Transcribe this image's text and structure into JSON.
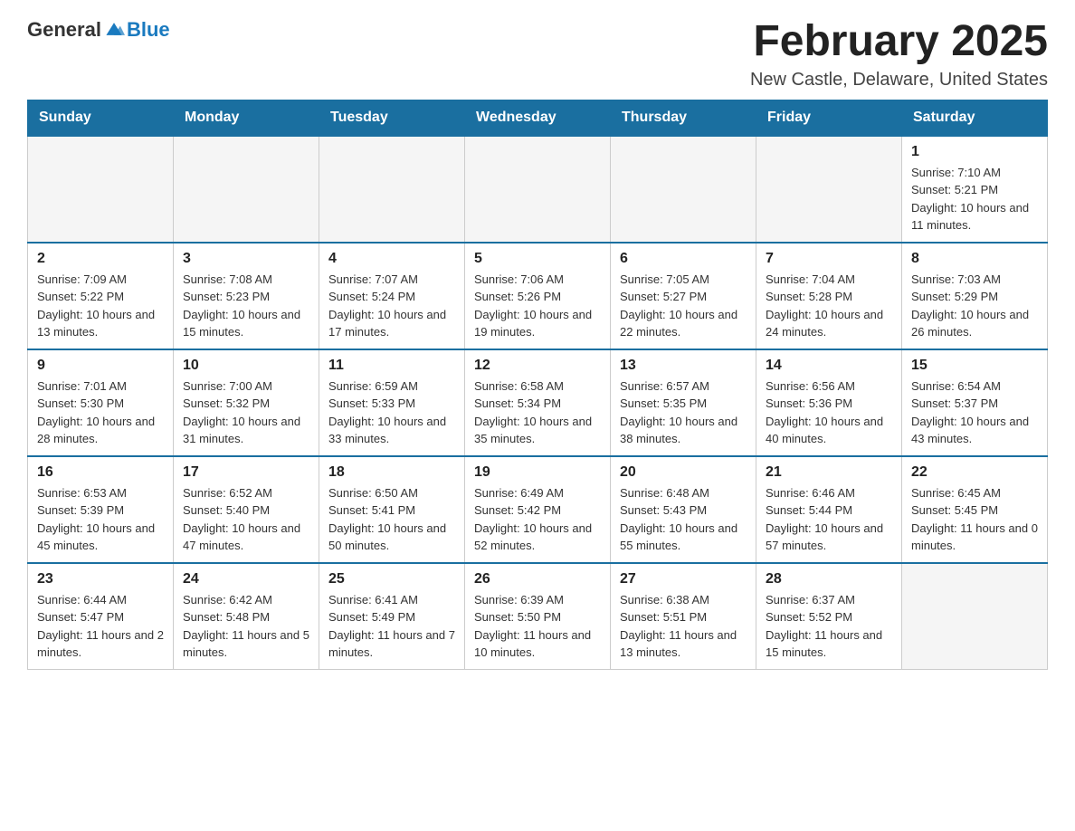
{
  "logo": {
    "general": "General",
    "blue": "Blue"
  },
  "title": "February 2025",
  "subtitle": "New Castle, Delaware, United States",
  "weekdays": [
    "Sunday",
    "Monday",
    "Tuesday",
    "Wednesday",
    "Thursday",
    "Friday",
    "Saturday"
  ],
  "weeks": [
    [
      {
        "day": "",
        "info": ""
      },
      {
        "day": "",
        "info": ""
      },
      {
        "day": "",
        "info": ""
      },
      {
        "day": "",
        "info": ""
      },
      {
        "day": "",
        "info": ""
      },
      {
        "day": "",
        "info": ""
      },
      {
        "day": "1",
        "info": "Sunrise: 7:10 AM\nSunset: 5:21 PM\nDaylight: 10 hours and 11 minutes."
      }
    ],
    [
      {
        "day": "2",
        "info": "Sunrise: 7:09 AM\nSunset: 5:22 PM\nDaylight: 10 hours and 13 minutes."
      },
      {
        "day": "3",
        "info": "Sunrise: 7:08 AM\nSunset: 5:23 PM\nDaylight: 10 hours and 15 minutes."
      },
      {
        "day": "4",
        "info": "Sunrise: 7:07 AM\nSunset: 5:24 PM\nDaylight: 10 hours and 17 minutes."
      },
      {
        "day": "5",
        "info": "Sunrise: 7:06 AM\nSunset: 5:26 PM\nDaylight: 10 hours and 19 minutes."
      },
      {
        "day": "6",
        "info": "Sunrise: 7:05 AM\nSunset: 5:27 PM\nDaylight: 10 hours and 22 minutes."
      },
      {
        "day": "7",
        "info": "Sunrise: 7:04 AM\nSunset: 5:28 PM\nDaylight: 10 hours and 24 minutes."
      },
      {
        "day": "8",
        "info": "Sunrise: 7:03 AM\nSunset: 5:29 PM\nDaylight: 10 hours and 26 minutes."
      }
    ],
    [
      {
        "day": "9",
        "info": "Sunrise: 7:01 AM\nSunset: 5:30 PM\nDaylight: 10 hours and 28 minutes."
      },
      {
        "day": "10",
        "info": "Sunrise: 7:00 AM\nSunset: 5:32 PM\nDaylight: 10 hours and 31 minutes."
      },
      {
        "day": "11",
        "info": "Sunrise: 6:59 AM\nSunset: 5:33 PM\nDaylight: 10 hours and 33 minutes."
      },
      {
        "day": "12",
        "info": "Sunrise: 6:58 AM\nSunset: 5:34 PM\nDaylight: 10 hours and 35 minutes."
      },
      {
        "day": "13",
        "info": "Sunrise: 6:57 AM\nSunset: 5:35 PM\nDaylight: 10 hours and 38 minutes."
      },
      {
        "day": "14",
        "info": "Sunrise: 6:56 AM\nSunset: 5:36 PM\nDaylight: 10 hours and 40 minutes."
      },
      {
        "day": "15",
        "info": "Sunrise: 6:54 AM\nSunset: 5:37 PM\nDaylight: 10 hours and 43 minutes."
      }
    ],
    [
      {
        "day": "16",
        "info": "Sunrise: 6:53 AM\nSunset: 5:39 PM\nDaylight: 10 hours and 45 minutes."
      },
      {
        "day": "17",
        "info": "Sunrise: 6:52 AM\nSunset: 5:40 PM\nDaylight: 10 hours and 47 minutes."
      },
      {
        "day": "18",
        "info": "Sunrise: 6:50 AM\nSunset: 5:41 PM\nDaylight: 10 hours and 50 minutes."
      },
      {
        "day": "19",
        "info": "Sunrise: 6:49 AM\nSunset: 5:42 PM\nDaylight: 10 hours and 52 minutes."
      },
      {
        "day": "20",
        "info": "Sunrise: 6:48 AM\nSunset: 5:43 PM\nDaylight: 10 hours and 55 minutes."
      },
      {
        "day": "21",
        "info": "Sunrise: 6:46 AM\nSunset: 5:44 PM\nDaylight: 10 hours and 57 minutes."
      },
      {
        "day": "22",
        "info": "Sunrise: 6:45 AM\nSunset: 5:45 PM\nDaylight: 11 hours and 0 minutes."
      }
    ],
    [
      {
        "day": "23",
        "info": "Sunrise: 6:44 AM\nSunset: 5:47 PM\nDaylight: 11 hours and 2 minutes."
      },
      {
        "day": "24",
        "info": "Sunrise: 6:42 AM\nSunset: 5:48 PM\nDaylight: 11 hours and 5 minutes."
      },
      {
        "day": "25",
        "info": "Sunrise: 6:41 AM\nSunset: 5:49 PM\nDaylight: 11 hours and 7 minutes."
      },
      {
        "day": "26",
        "info": "Sunrise: 6:39 AM\nSunset: 5:50 PM\nDaylight: 11 hours and 10 minutes."
      },
      {
        "day": "27",
        "info": "Sunrise: 6:38 AM\nSunset: 5:51 PM\nDaylight: 11 hours and 13 minutes."
      },
      {
        "day": "28",
        "info": "Sunrise: 6:37 AM\nSunset: 5:52 PM\nDaylight: 11 hours and 15 minutes."
      },
      {
        "day": "",
        "info": ""
      }
    ]
  ],
  "colors": {
    "header_bg": "#1a6fa0",
    "header_text": "#ffffff",
    "border": "#cccccc",
    "empty_bg": "#f5f5f5"
  }
}
